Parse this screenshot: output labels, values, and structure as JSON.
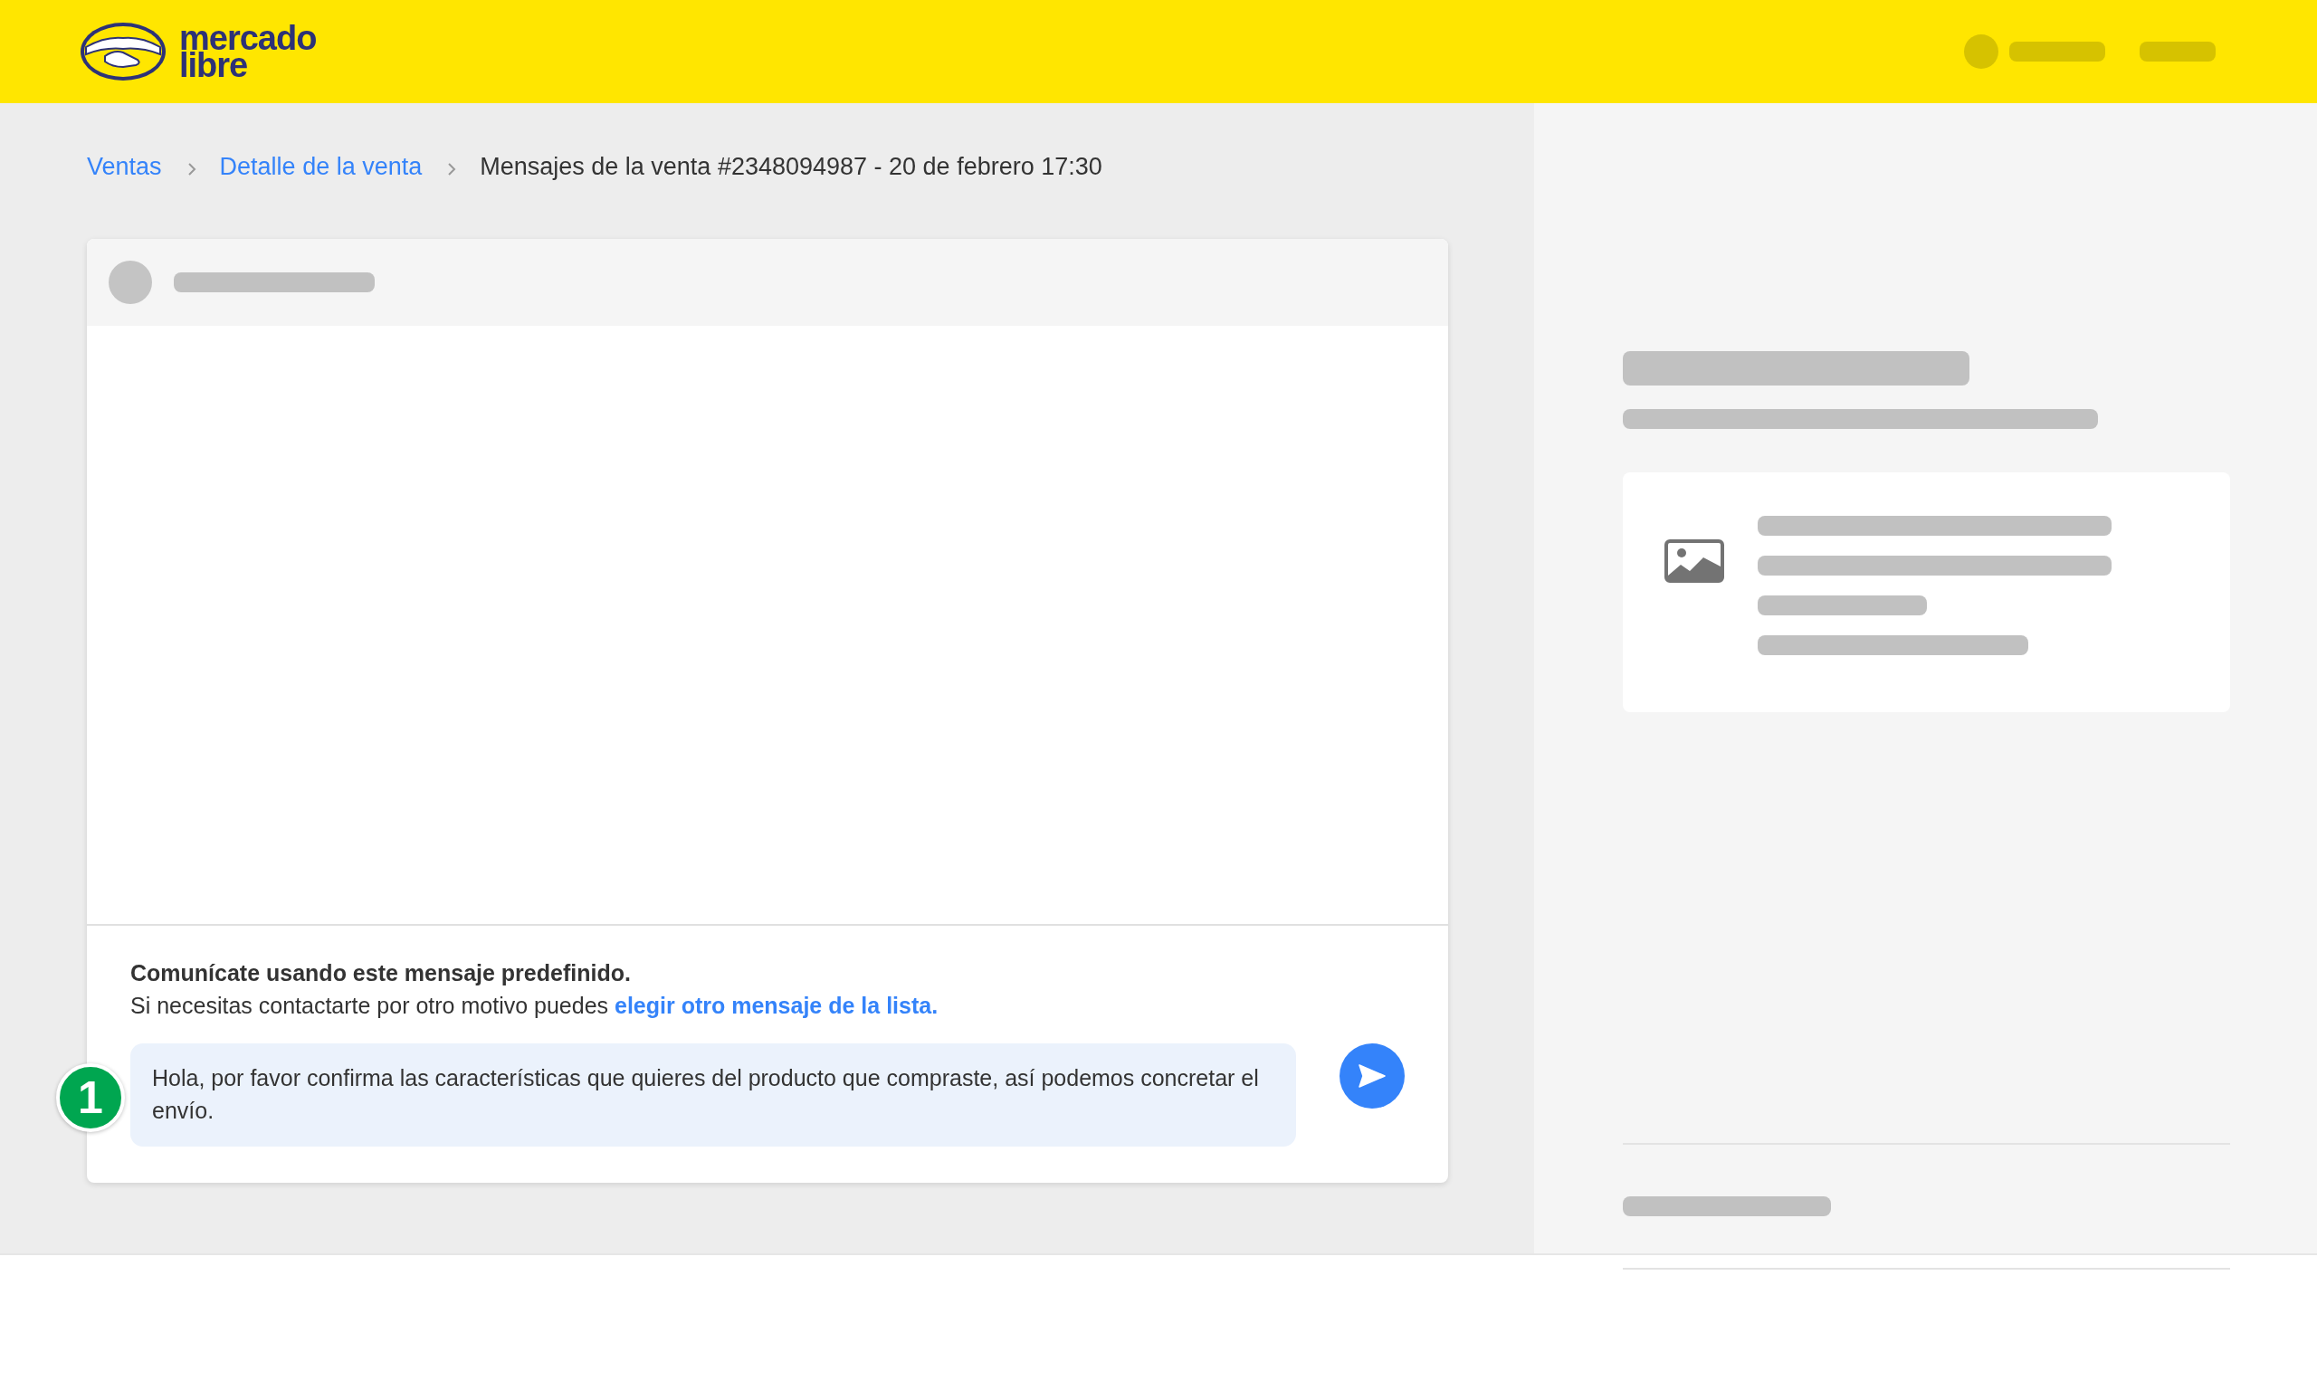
{
  "header": {
    "logo_lines": [
      "mercado",
      "libre"
    ]
  },
  "breadcrumb": [
    {
      "label": "Ventas",
      "kind": "link"
    },
    {
      "label": "Detalle de la venta",
      "kind": "link"
    },
    {
      "label": "Mensajes de la venta #2348094987 - 20 de febrero 17:30",
      "kind": "current"
    }
  ],
  "composer": {
    "title": "Comunícate usando este mensaje predefinido.",
    "hint": "Si necesitas contactarte por otro motivo puedes ",
    "link": "elegir otro mensaje de la lista.",
    "message": "Hola, por favor confirma las características que quieres del producto que compraste, así podemos concretar el envío.",
    "step_badge": "1"
  }
}
